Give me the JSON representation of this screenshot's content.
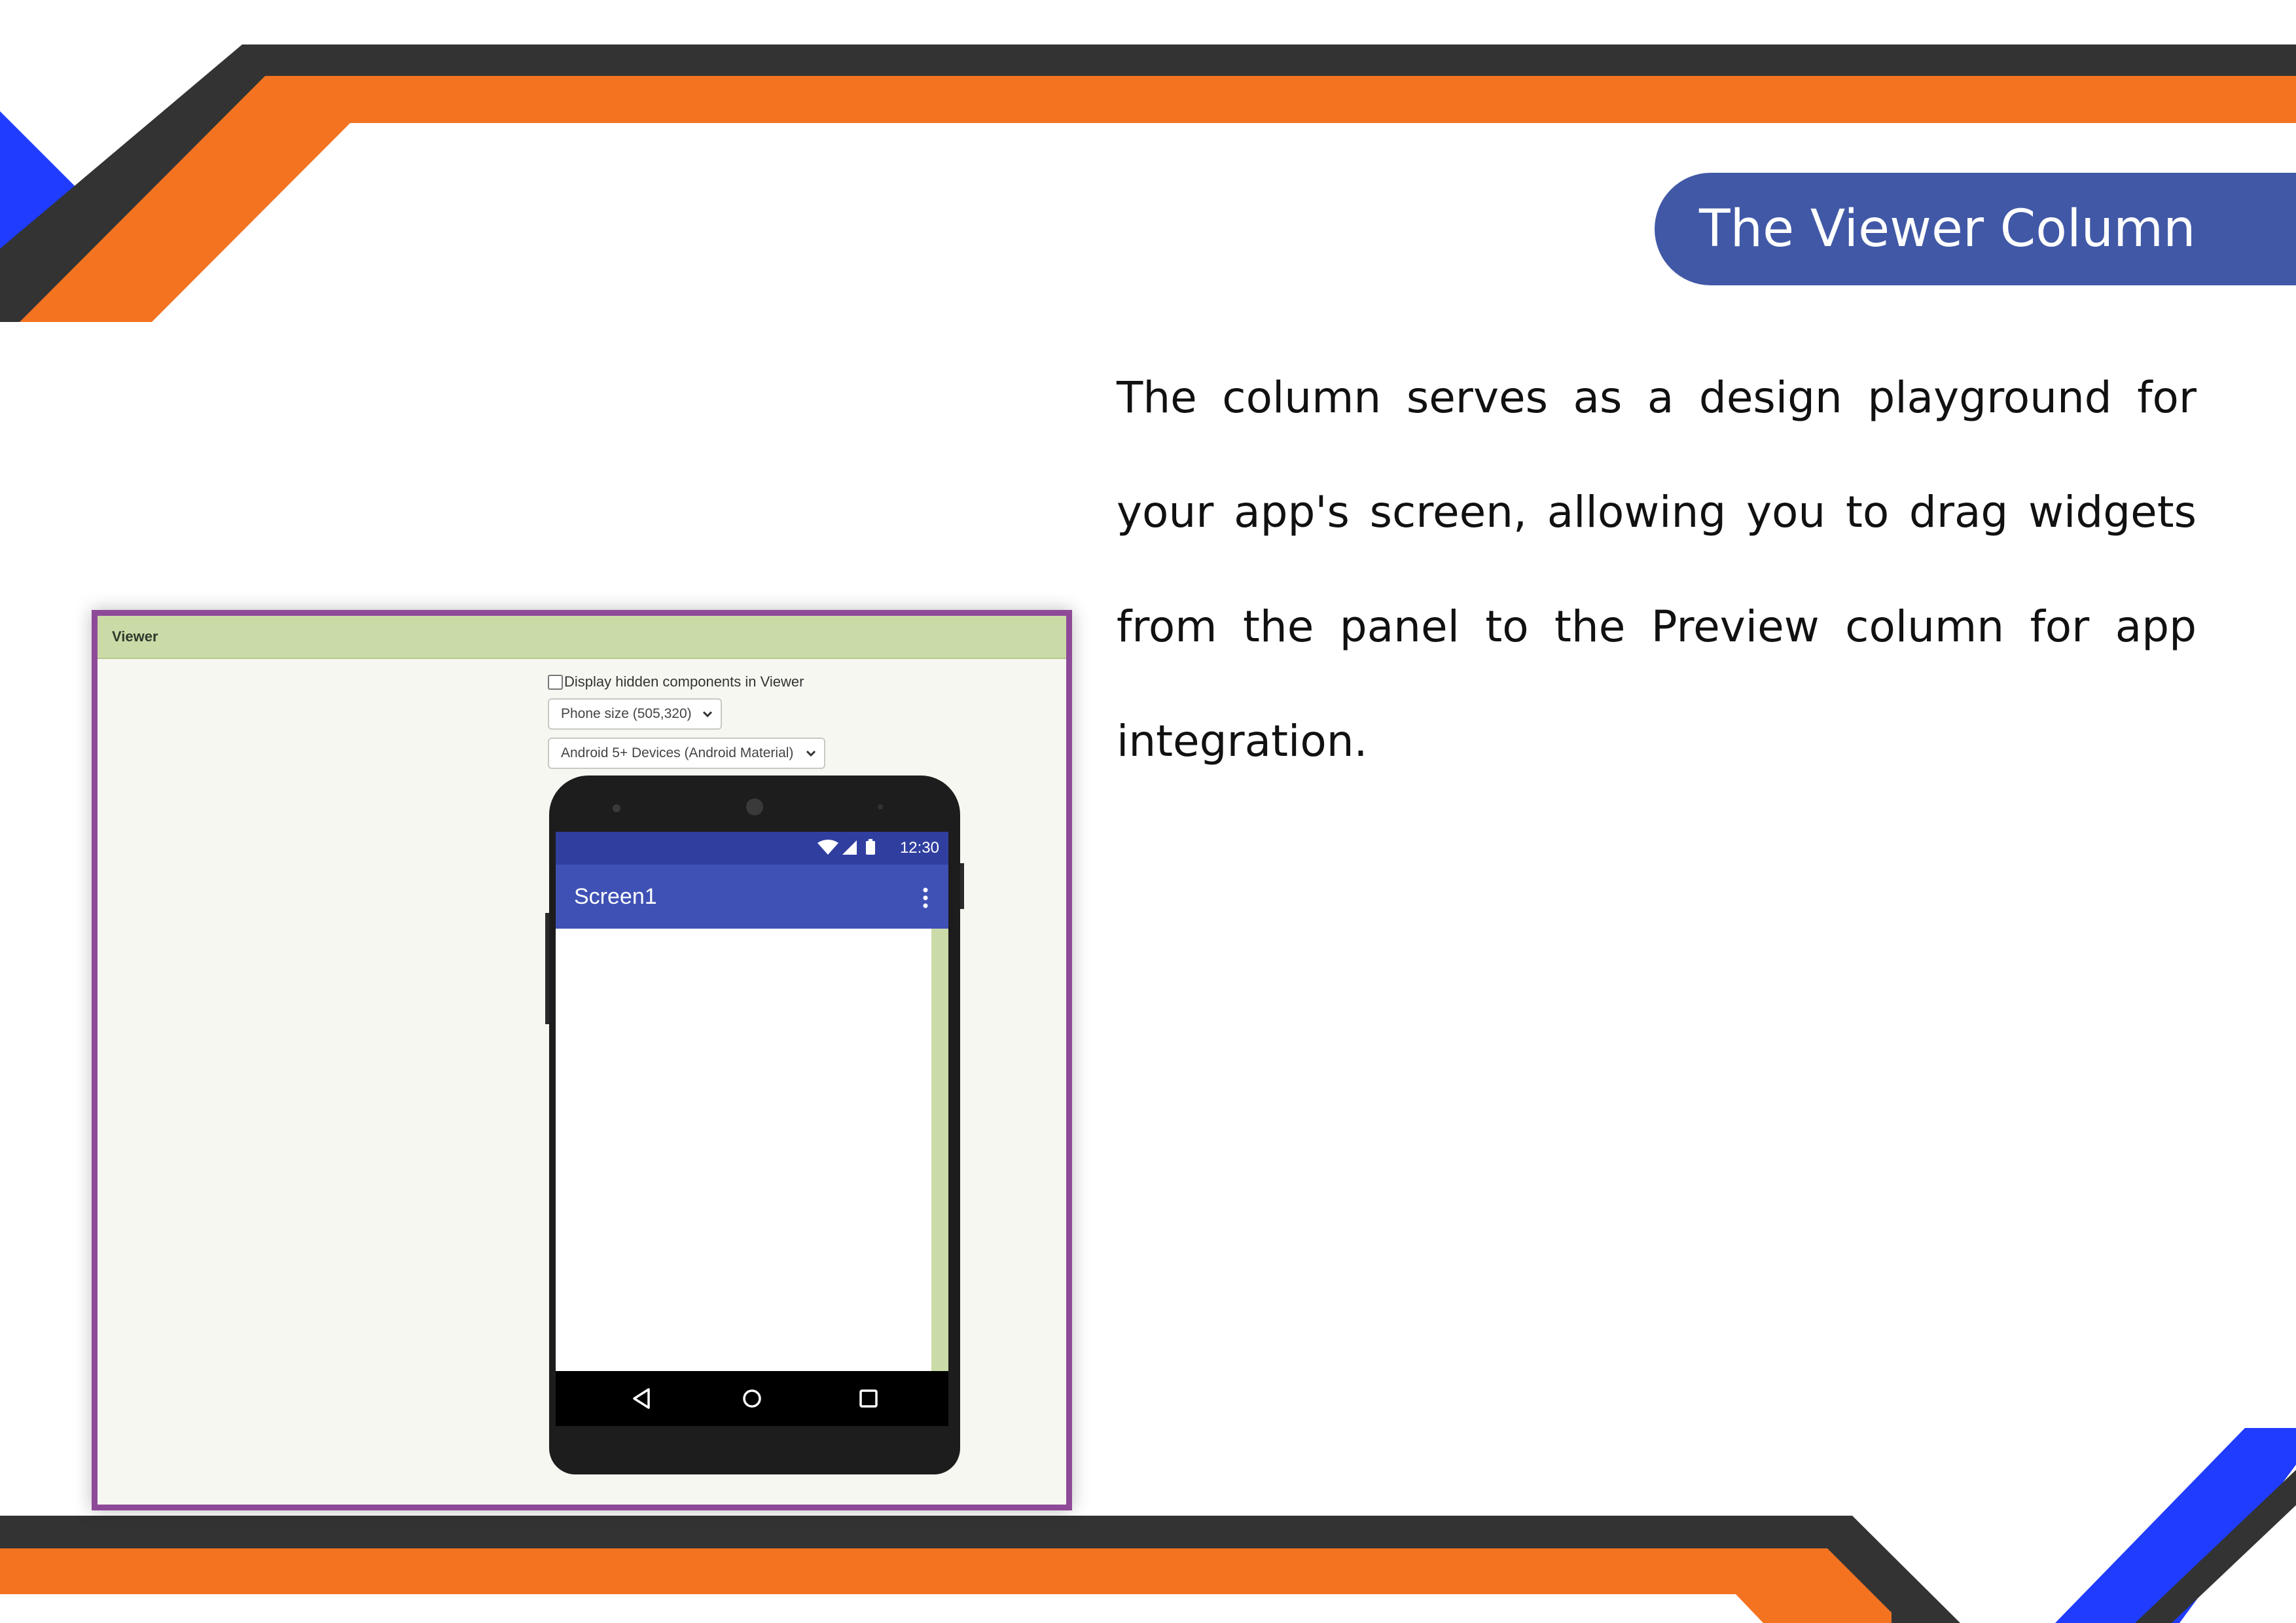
{
  "slide": {
    "title": "The Viewer Column",
    "body": "The column serves as a design playground for your app's screen, allowing you to drag widgets from the panel to the Preview column for app integration.",
    "colors": {
      "orange": "#f37321",
      "dark": "#333333",
      "blue": "#1f3cff",
      "title_bg": "#4158a6",
      "frame": "#8e4a98"
    }
  },
  "viewer": {
    "header": "Viewer",
    "hidden_checkbox_label": "Display hidden components in Viewer",
    "hidden_checkbox_checked": false,
    "size_select": "Phone size (505,320)",
    "theme_select": "Android 5+ Devices (Android Material)",
    "phone": {
      "status_time": "12:30",
      "status_icons": [
        "wifi-icon",
        "signal-icon",
        "battery-icon"
      ],
      "screen_title": "Screen1",
      "menu_icon": "overflow-menu-icon",
      "nav_icons": [
        "back-icon",
        "home-icon",
        "recents-icon"
      ]
    }
  }
}
